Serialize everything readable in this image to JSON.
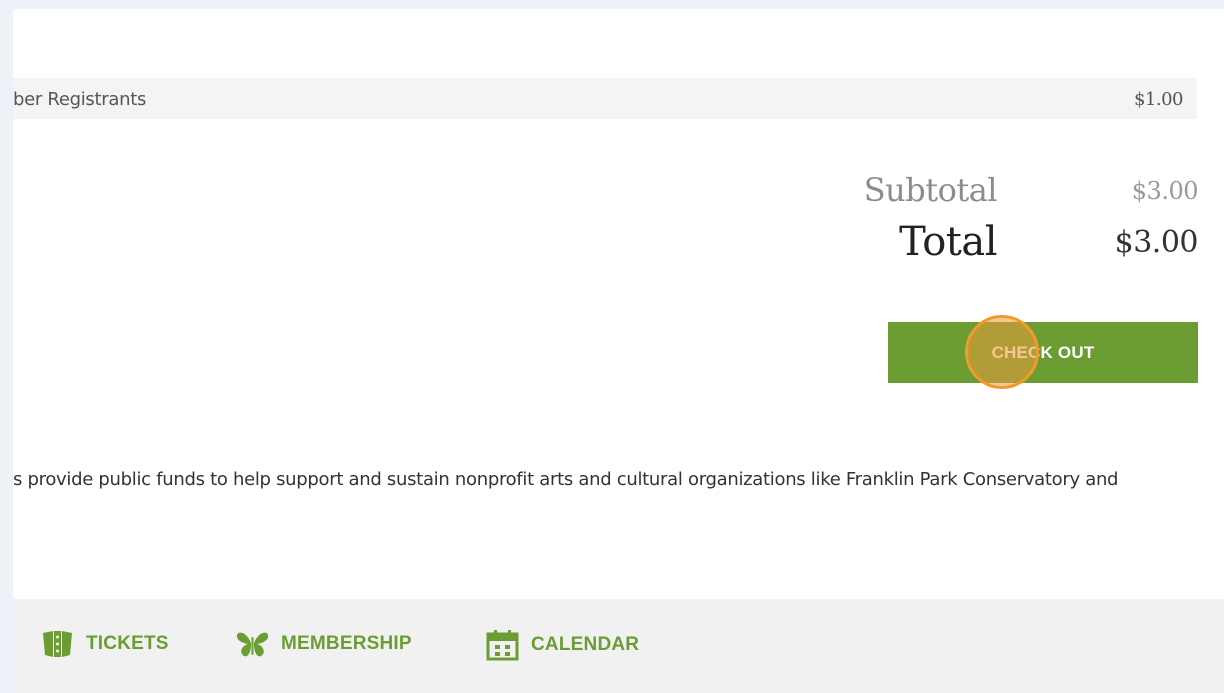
{
  "cart": {
    "line_item": {
      "label": "ber Registrants",
      "price": "$1.00"
    },
    "subtotal_label": "Subtotal",
    "subtotal_value": "$3.00",
    "total_label": "Total",
    "total_value": "$3.00",
    "checkout_label": "CHECK OUT"
  },
  "footnote": "s provide public funds to help support and sustain nonprofit arts and cultural organizations like Franklin Park Conservatory and",
  "footer_nav": {
    "items": [
      {
        "label": "TICKETS",
        "icon": "tickets-icon"
      },
      {
        "label": "MEMBERSHIP",
        "icon": "butterfly-icon"
      },
      {
        "label": "CALENDAR",
        "icon": "calendar-icon"
      }
    ]
  },
  "colors": {
    "accent_green": "#6c9d33",
    "click_marker": "#f39a2c"
  }
}
